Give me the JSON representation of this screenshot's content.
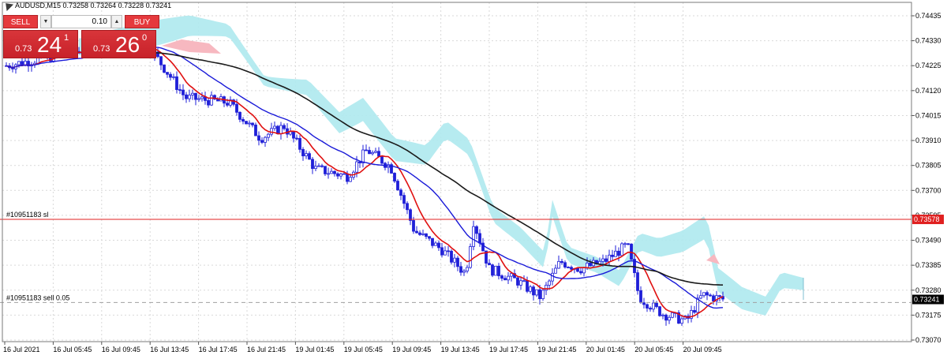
{
  "header": {
    "symbol_info": "AUDUSD,M15  0.73258 0.73264 0.73228 0.73241"
  },
  "trade_panel": {
    "sell_label": "SELL",
    "buy_label": "BUY",
    "lot_value": "0.10",
    "down_arrow": "▼",
    "up_arrow": "▲",
    "sell_price_prefix": "0.73",
    "sell_price_big": "24",
    "sell_price_sup": "1",
    "buy_price_prefix": "0.73",
    "buy_price_big": "26",
    "buy_price_sup": "0"
  },
  "price_axis": {
    "labels": [
      "0.74435",
      "0.74330",
      "0.74225",
      "0.74120",
      "0.74015",
      "0.73910",
      "0.73805",
      "0.73700",
      "0.73595",
      "0.73490",
      "0.73385",
      "0.73280",
      "0.73175",
      "0.73070"
    ],
    "range": [
      0.7307,
      0.74435
    ],
    "sl_price_badge": "0.73578",
    "current_price_badge": "0.73241"
  },
  "order_lines": {
    "sl_label": "#10951183 sl",
    "sl_price": 0.73578,
    "entry_label": "#10951183 sell 0.05",
    "entry_price": 0.73228
  },
  "time_axis": {
    "labels": [
      "16 Jul 2021",
      "16 Jul 05:45",
      "16 Jul 09:45",
      "16 Jul 13:45",
      "16 Jul 17:45",
      "16 Jul 21:45",
      "19 Jul 01:45",
      "19 Jul 05:45",
      "19 Jul 09:45",
      "19 Jul 13:45",
      "19 Jul 17:45",
      "19 Jul 21:45",
      "20 Jul 01:45",
      "20 Jul 05:45",
      "20 Jul 09:45"
    ]
  },
  "colors": {
    "bull": "#1f1fd8",
    "bear": "#1f1fd8",
    "ma_fast": "#e01010",
    "ma_mid": "#1a1ad8",
    "ma_slow": "#1a1a1a",
    "cloud_bear": "#aee9ee",
    "cloud_bull": "#f7b8c0",
    "sl_line": "#e02020",
    "grid": "#d9d9d9"
  },
  "icons": {
    "title_icon": "one-click-trading-icon"
  }
}
